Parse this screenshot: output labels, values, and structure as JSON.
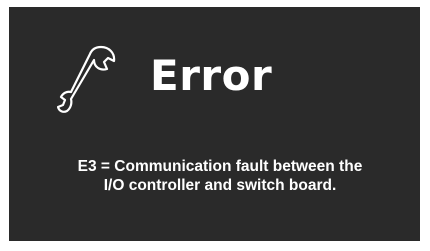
{
  "error_screen": {
    "icon": "wrench-icon",
    "title": "Error",
    "message_line1": "E3 = Communication fault between the",
    "message_line2": "I/O controller and switch board."
  },
  "colors": {
    "background": "#2a2a2a",
    "text": "#ffffff"
  }
}
